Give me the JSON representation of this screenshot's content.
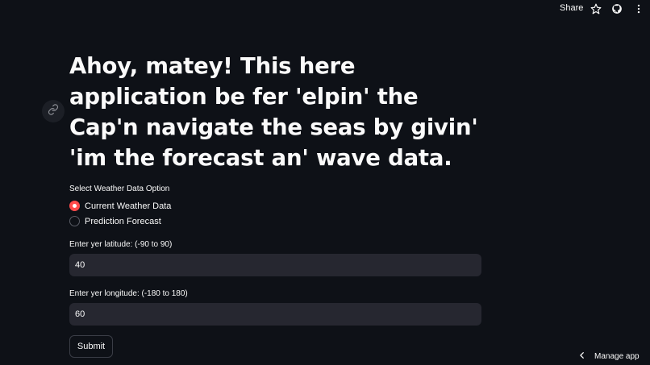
{
  "header": {
    "share_label": "Share",
    "icons": [
      "star-icon",
      "github-icon",
      "kebab-menu-icon"
    ]
  },
  "main": {
    "title": "Ahoy, matey! This here application be fer 'elpin' the Cap'n navigate the seas by givin' 'im the forecast an' wave data.",
    "weather_option": {
      "label": "Select Weather Data Option",
      "options": [
        "Current Weather Data",
        "Prediction Forecast"
      ],
      "selected": "Current Weather Data"
    },
    "latitude": {
      "label": "Enter yer latitude: (-90 to 90)",
      "value": "40"
    },
    "longitude": {
      "label": "Enter yer longitude: (-180 to 180)",
      "value": "60"
    },
    "submit_label": "Submit"
  },
  "footer": {
    "manage_label": "Manage app"
  },
  "colors": {
    "background": "#0e1117",
    "accent": "#ff4b4b",
    "input_bg": "#262730"
  }
}
